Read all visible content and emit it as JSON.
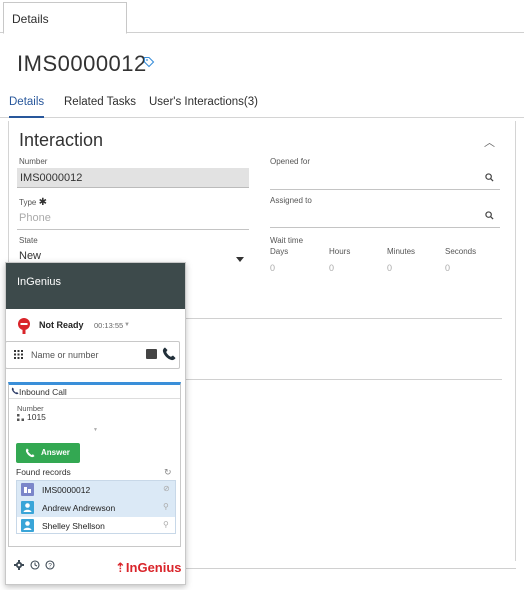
{
  "top_tab": {
    "label": "Details"
  },
  "record": {
    "title": "IMS0000012"
  },
  "tabs": [
    {
      "label": "Details",
      "active": true
    },
    {
      "label": "Related Tasks",
      "active": false
    },
    {
      "label": "User's Interactions(3)",
      "active": false
    }
  ],
  "section": {
    "title": "Interaction"
  },
  "fields": {
    "number": {
      "label": "Number",
      "value": "IMS0000012"
    },
    "type": {
      "label": "Type",
      "required_mark": "✱",
      "placeholder": "Phone"
    },
    "state": {
      "label": "State",
      "value": "New"
    },
    "opened_for": {
      "label": "Opened for",
      "value": ""
    },
    "assigned_to": {
      "label": "Assigned to",
      "value": ""
    },
    "wait_time": {
      "label": "Wait time",
      "columns": [
        "Days",
        "Hours",
        "Minutes",
        "Seconds"
      ],
      "values": [
        "0",
        "0",
        "0",
        "0"
      ]
    }
  },
  "ingenius": {
    "header": "InGenius",
    "status": {
      "text": "Not Ready",
      "timer": "00:13:55"
    },
    "dial": {
      "placeholder": "Name or number"
    },
    "call": {
      "header": "Inbound Call",
      "number_label": "Number",
      "number": "1015",
      "answer_label": "Answer"
    },
    "found_records": {
      "label": "Found records",
      "items": [
        {
          "label": "IMS0000012",
          "icon": "record-icon",
          "color": "#7b86c9",
          "selected": true
        },
        {
          "label": "Andrew Andrewson",
          "icon": "user-icon",
          "color": "#3aa5d8",
          "selected": true
        },
        {
          "label": "Shelley Shellson",
          "icon": "user-icon",
          "color": "#3aa5d8",
          "selected": false
        }
      ]
    },
    "brand": "InGenius",
    "brand_prefix": "⇡"
  },
  "colors": {
    "active_tab": "#28579b",
    "ingenius_header": "#3d4a4b",
    "answer": "#33a852",
    "brand": "#d9242a",
    "status": "#d9242a"
  }
}
